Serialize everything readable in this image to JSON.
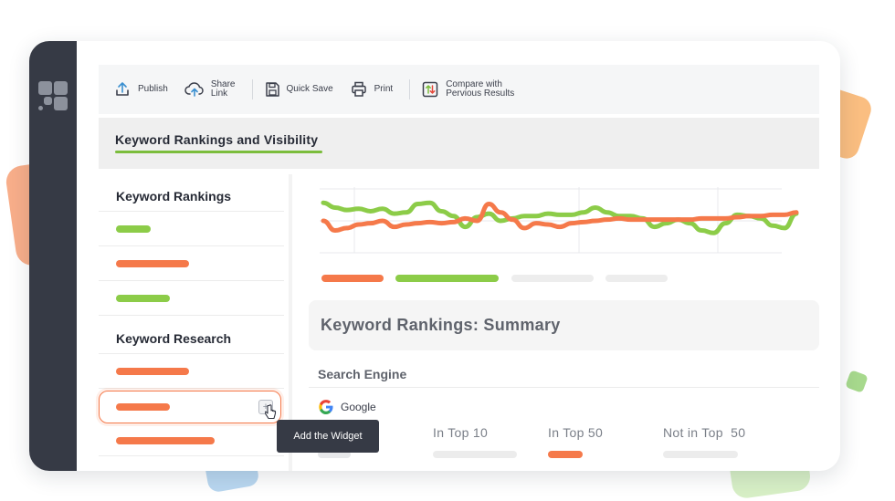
{
  "toolbar": {
    "publish_label": "Publish",
    "share_label_line1": "Share",
    "share_label_line2": "Link",
    "quick_save_label": "Quick Save",
    "print_label": "Print",
    "compare_label_line1": "Compare with",
    "compare_label_line2": "Pervious Results"
  },
  "header": {
    "title": "Keyword Rankings and Visibility",
    "accent_color": "#7bbd3c"
  },
  "left_panel": {
    "section1_title": "Keyword Rankings",
    "section2_title": "Keyword Research",
    "selected_row": 5
  },
  "tooltip": {
    "text": "Add the Widget"
  },
  "chart_data": {
    "type": "line",
    "title": "",
    "xlabel": "",
    "ylabel": "",
    "x": [
      0,
      1,
      2,
      3,
      4,
      5,
      6,
      7,
      8,
      9,
      10,
      11,
      12,
      13,
      14,
      15,
      16,
      17,
      18,
      19,
      20,
      21,
      22,
      23,
      24,
      25,
      26,
      27,
      28,
      29,
      30,
      31,
      32,
      33,
      34,
      35,
      36,
      37,
      38,
      39,
      40
    ],
    "ylim": [
      0,
      100
    ],
    "grid": true,
    "series": [
      {
        "color": "#8ccc48",
        "values": [
          80,
          72,
          68,
          70,
          66,
          70,
          62,
          64,
          78,
          80,
          66,
          58,
          40,
          56,
          62,
          50,
          54,
          58,
          58,
          62,
          60,
          60,
          64,
          72,
          64,
          58,
          58,
          54,
          40,
          46,
          52,
          46,
          34,
          30,
          46,
          60,
          58,
          54,
          42,
          38,
          62
        ]
      },
      {
        "color": "#f5794a",
        "values": [
          50,
          34,
          38,
          44,
          46,
          50,
          40,
          44,
          46,
          48,
          46,
          48,
          54,
          50,
          78,
          64,
          52,
          38,
          46,
          44,
          40,
          46,
          48,
          50,
          52,
          54,
          52,
          52,
          52,
          52,
          52,
          52,
          54,
          54,
          54,
          56,
          58,
          58,
          60,
          60,
          64
        ]
      }
    ]
  },
  "summary": {
    "title": "Keyword Rankings: Summary",
    "search_engine_label": "Search Engine",
    "engine_name": "Google",
    "col_top10": "In Top 10",
    "col_top50": "In Top 50",
    "col_not_top50": "Not in Top  50"
  },
  "colors": {
    "sidebar": "#363a45",
    "green": "#8ccc48",
    "orange": "#f5794a",
    "grey_placeholder": "#e7e8ea"
  },
  "icons": {
    "logo": "app-logo-grid-icon",
    "publish": "upload-icon",
    "share": "cloud-upload-icon",
    "quick_save": "floppy-disk-icon",
    "print": "printer-icon",
    "compare": "compare-arrows-icon",
    "add_widget": "plus-icon",
    "cursor": "pointer-hand-icon",
    "google": "google-icon"
  }
}
